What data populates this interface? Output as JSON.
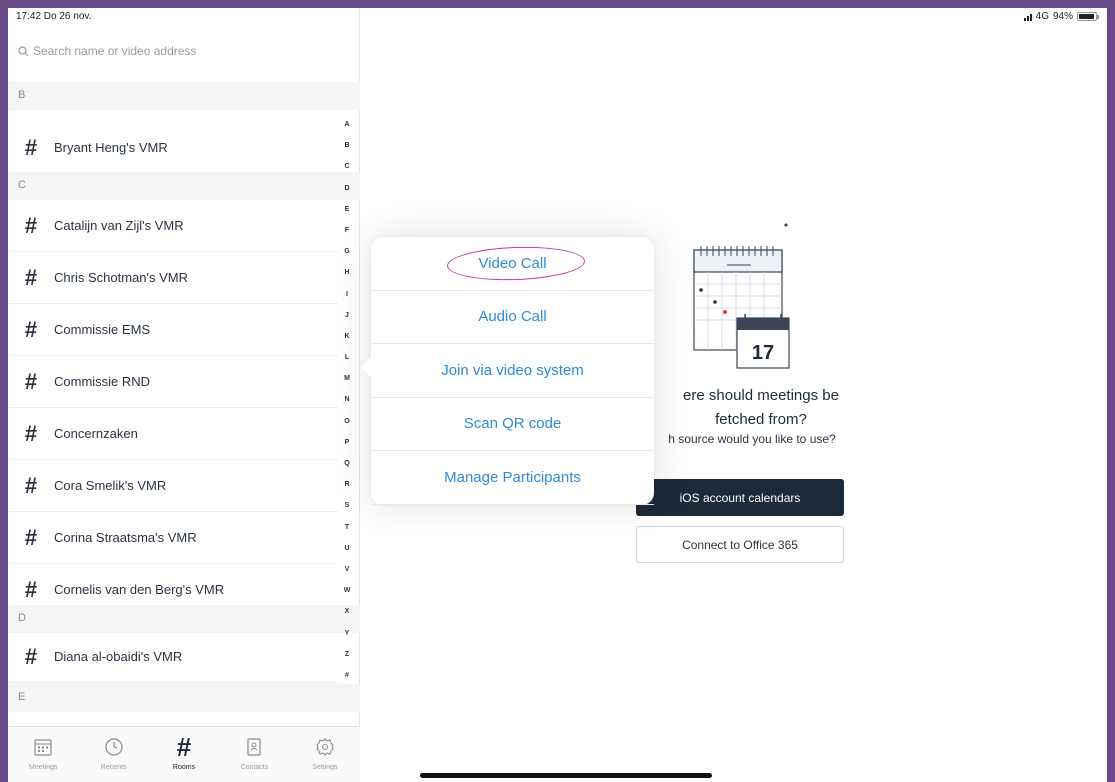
{
  "status_bar": {
    "time": "17:42  Do 26 nov.",
    "network": "4G",
    "battery": "94%",
    "battery_level": 0.94
  },
  "search": {
    "placeholder": "Search name or video address"
  },
  "sections": [
    {
      "header": "B",
      "rooms": [
        "Bryant Heng's VMR"
      ]
    },
    {
      "header": "C",
      "rooms": [
        "Catalijn van Zijl's VMR",
        "Chris Schotman's VMR",
        "Commissie EMS",
        "Commissie RND",
        "Concernzaken",
        "Cora Smelik's VMR",
        "Corina Straatsma's VMR",
        "Cornelis van den Berg's VMR"
      ]
    },
    {
      "header": "D",
      "rooms": [
        "Diana al-obaidi's VMR"
      ]
    },
    {
      "header": "E",
      "rooms": []
    }
  ],
  "alpha_index": [
    "A",
    "B",
    "C",
    "D",
    "E",
    "F",
    "G",
    "H",
    "I",
    "J",
    "K",
    "L",
    "M",
    "N",
    "O",
    "P",
    "Q",
    "R",
    "S",
    "T",
    "U",
    "V",
    "W",
    "X",
    "Y",
    "Z",
    "#"
  ],
  "tabs": [
    {
      "label": "Meetings",
      "icon": "calendar-icon",
      "active": false
    },
    {
      "label": "Recents",
      "icon": "clock-icon",
      "active": false
    },
    {
      "label": "Rooms",
      "icon": "hash-icon",
      "active": true
    },
    {
      "label": "Contacts",
      "icon": "contacts-book-icon",
      "active": false
    },
    {
      "label": "Settings",
      "icon": "gear-icon",
      "active": false
    }
  ],
  "popover": {
    "items": [
      "Video Call",
      "Audio Call",
      "Join via video system",
      "Scan QR code",
      "Manage Participants"
    ],
    "highlighted": "Video Call"
  },
  "calendar_prompt": {
    "calendar_day": "17",
    "title_line1": "ere should meetings be",
    "title_line2": "fetched from?",
    "subtitle": "h source would you like to use?",
    "ios_button": "iOS account calendars",
    "office_button": "Connect to Office 365"
  },
  "colors": {
    "accent": "#2f8ad8",
    "dark_button": "#1d2a3b",
    "annotation": "#c437a8",
    "frame": "#6a4a86"
  }
}
